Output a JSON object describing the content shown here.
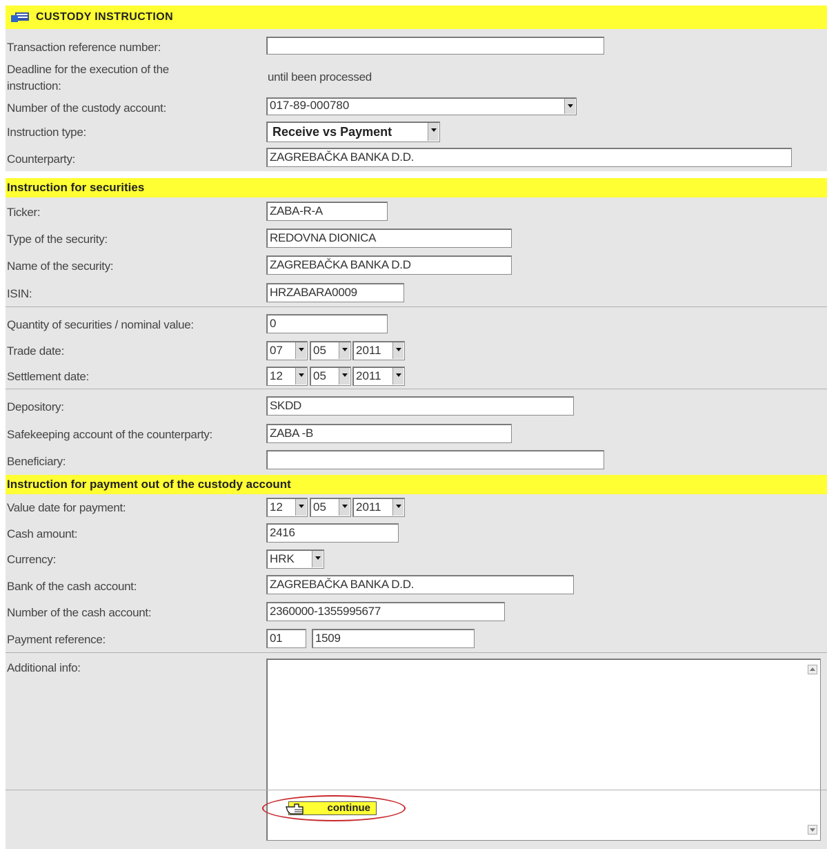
{
  "header": {
    "title": "CUSTODY INSTRUCTION"
  },
  "sections": {
    "securities": "Instruction for securities",
    "payment": "Instruction for payment out of the custody account"
  },
  "labels": {
    "transaction_ref": "Transaction reference number:",
    "deadline_1": "Deadline for the execution of the",
    "deadline_2": "instruction:",
    "custody_account": "Number of the custody account:",
    "instruction_type": "Instruction type:",
    "counterparty": "Counterparty:",
    "ticker": "Ticker:",
    "security_type": "Type of the security:",
    "security_name": "Name of the security:",
    "isin": "ISIN:",
    "quantity": "Quantity of securities / nominal value:",
    "trade_date": "Trade date:",
    "settlement_date": "Settlement date:",
    "depository": "Depository:",
    "safekeeping": "Safekeeping account of the counterparty:",
    "beneficiary": "Beneficiary:",
    "value_date": "Value date for payment:",
    "cash_amount": "Cash amount:",
    "currency": "Currency:",
    "bank": "Bank of the cash account:",
    "cash_account": "Number of the cash account:",
    "payment_ref": "Payment reference:",
    "additional": "Additional info:"
  },
  "values": {
    "transaction_ref": "",
    "deadline": "until been processed",
    "custody_account": "017-89-000780",
    "instruction_type": "Receive vs Payment",
    "counterparty": "ZAGREBAČKA BANKA D.D.",
    "ticker": "ZABA-R-A",
    "security_type": "REDOVNA DIONICA",
    "security_name": "ZAGREBAČKA BANKA D.D",
    "isin": "HRZABARA0009",
    "quantity": "0",
    "trade_date": {
      "day": "07",
      "month": "05",
      "year": "2011"
    },
    "settlement_date": {
      "day": "12",
      "month": "05",
      "year": "2011"
    },
    "depository": "SKDD",
    "safekeeping": "ZABA -B",
    "beneficiary": "",
    "value_date": {
      "day": "12",
      "month": "05",
      "year": "2011"
    },
    "cash_amount": "2416",
    "currency": "HRK",
    "bank": "ZAGREBAČKA BANKA D.D.",
    "cash_account": "2360000-1355995677",
    "payment_ref_model": "01",
    "payment_ref_number": "1509",
    "additional": ""
  },
  "buttons": {
    "continue": "continue"
  },
  "colors": {
    "header": "#ffff33",
    "panel": "#e6e6e6",
    "highlight_circle": "#c8282d"
  },
  "icons": [
    "form-icon",
    "hand-pointer-icon",
    "dropdown-arrow-icon"
  ]
}
